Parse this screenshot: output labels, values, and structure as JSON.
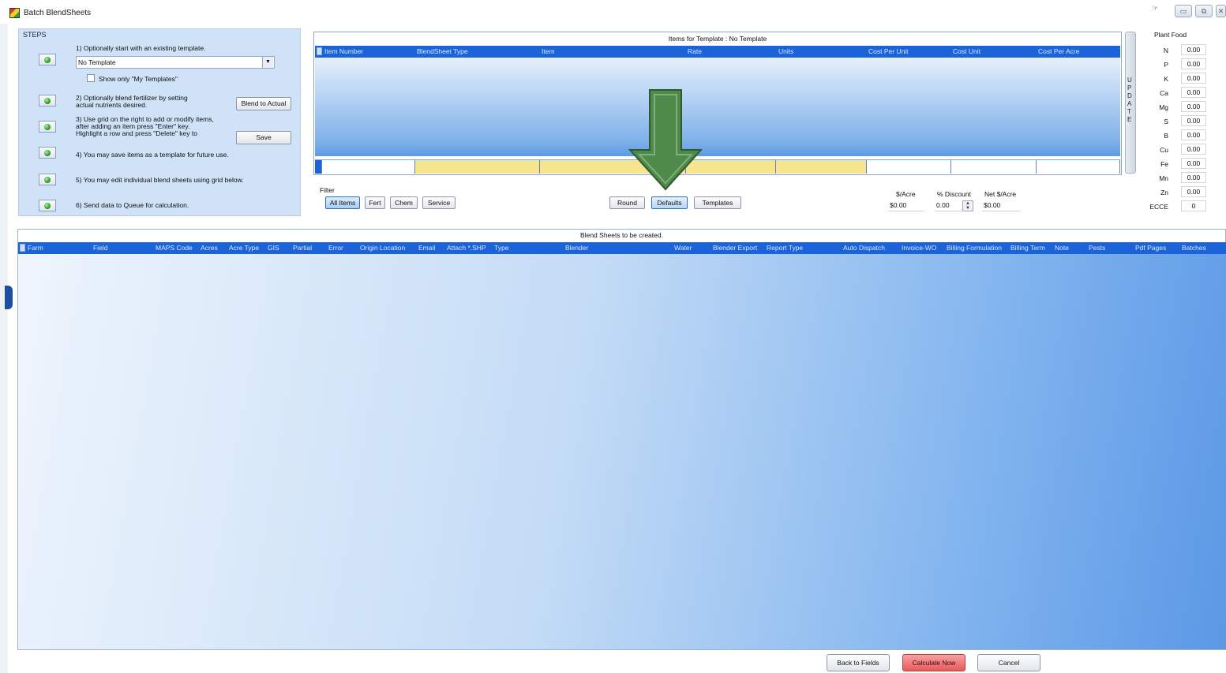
{
  "window": {
    "title": "Batch BlendSheets",
    "help_glyph": "☞",
    "min_glyph": "▭",
    "max_glyph": "⧉",
    "close_glyph": "✕"
  },
  "steps": {
    "label": "STEPS",
    "step1": "1) Optionally start with an existing template.",
    "template_value": "No Template",
    "template_arrow": "▼",
    "show_only_my_templates": "Show only \"My Templates\"",
    "step2_line1": "2) Optionally blend fertilizer by setting",
    "step2_line2": "actual nutrients desired.",
    "blend_to_actual": "Blend to Actual",
    "step3_line1": "3) Use grid on the right to add or modify items,",
    "step3_line2": "after adding an item press \"Enter\" key.",
    "step3_line3": "Highlight a row and press \"Delete\" key to",
    "save": "Save",
    "step4": "4) You may save items as a template for future use.",
    "step5": "5) You may edit individual blend sheets using grid below.",
    "step6": "6) Send data to Queue for calculation."
  },
  "items_grid": {
    "caption": "Items for Template : No Template",
    "columns": [
      "Item Number",
      "BlendSheet Type",
      "Item",
      "Rate",
      "Units",
      "Cost Per Unit",
      "Cost Unit",
      "Cost Per Acre"
    ],
    "update_label": "UPDATE"
  },
  "filter": {
    "label": "Filter",
    "all_items": "All Items",
    "fert": "Fert",
    "chem": "Chem",
    "service": "Service",
    "round": "Round",
    "defaults": "Defaults",
    "templates": "Templates"
  },
  "cost": {
    "per_acre_label": "$/Acre",
    "per_acre_value": "$0.00",
    "discount_label": "% Discount",
    "discount_value": "0.00",
    "net_label": "Net $/Acre",
    "net_value": "$0.00"
  },
  "plant_food": {
    "title": "Plant Food",
    "nutrients": [
      {
        "label": "N",
        "value": "0.00"
      },
      {
        "label": "P",
        "value": "0.00"
      },
      {
        "label": "K",
        "value": "0.00"
      },
      {
        "label": "Ca",
        "value": "0.00"
      },
      {
        "label": "Mg",
        "value": "0.00"
      },
      {
        "label": "S",
        "value": "0.00"
      },
      {
        "label": "B",
        "value": "0.00"
      },
      {
        "label": "Cu",
        "value": "0.00"
      },
      {
        "label": "Fe",
        "value": "0.00"
      },
      {
        "label": "Mn",
        "value": "0.00"
      },
      {
        "label": "Zn",
        "value": "0.00"
      },
      {
        "label": "ECCE",
        "value": "0"
      }
    ]
  },
  "blend_grid": {
    "caption": "Blend Sheets to be created.",
    "columns": [
      "Farm",
      "Field",
      "MAPS Code",
      "Acres",
      "Acre Type",
      "GIS",
      "Partial",
      "Error",
      "Origin Location",
      "Email",
      "Attach *.SHP",
      "Type",
      "Blender",
      "Water",
      "Blender Export",
      "Report Type",
      "Auto Dispatch",
      "Invoice-WO",
      "Billing Formulation",
      "Billing Term",
      "Note",
      "Pests",
      "Pdf Pages",
      "Batches"
    ]
  },
  "footer": {
    "back": "Back to Fields",
    "calculate": "Calculate Now",
    "cancel": "Cancel"
  },
  "colors": {
    "header_blue": "#1a63d8",
    "arrow_green": "#4f8a4a",
    "calc_red": "#e85a5a",
    "new_row_yellow": "#f6e48e"
  }
}
